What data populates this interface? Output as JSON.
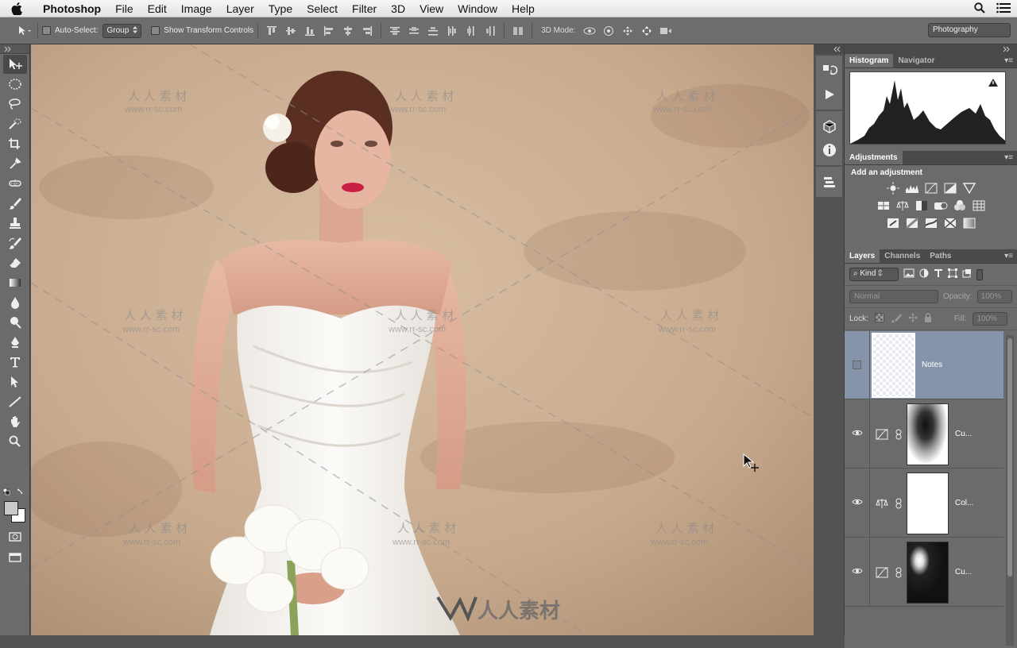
{
  "menubar": {
    "app_name": "Photoshop",
    "items": [
      "File",
      "Edit",
      "Image",
      "Layer",
      "Type",
      "Select",
      "Filter",
      "3D",
      "View",
      "Window",
      "Help"
    ]
  },
  "options_bar": {
    "auto_select_label": "Auto-Select:",
    "auto_select_value": "Group",
    "transform_controls_label": "Show Transform Controls",
    "mode_3d_label": "3D Mode:",
    "workspace": "Photography"
  },
  "tools": [
    "move-tool",
    "marquee-tool",
    "lasso-tool",
    "quick-select-tool",
    "crop-tool",
    "eyedropper-tool",
    "spot-healing-tool",
    "brush-tool",
    "clone-stamp-tool",
    "history-brush-tool",
    "eraser-tool",
    "gradient-tool",
    "blur-tool",
    "dodge-tool",
    "pen-tool",
    "type-tool",
    "path-select-tool",
    "line-tool",
    "hand-tool",
    "zoom-tool"
  ],
  "histogram_panel": {
    "tabs": [
      "Histogram",
      "Navigator"
    ]
  },
  "adjustments_panel": {
    "tab": "Adjustments",
    "title": "Add an adjustment"
  },
  "layers_panel": {
    "tabs": [
      "Layers",
      "Channels",
      "Paths"
    ],
    "filter_kind": "Kind",
    "blend_mode": "Normal",
    "opacity_label": "Opacity:",
    "opacity_value": "100%",
    "lock_label": "Lock:",
    "fill_label": "Fill:",
    "fill_value": "100%",
    "layers": [
      {
        "name": "Notes",
        "selected": true,
        "visible": false
      },
      {
        "name": "Cu...",
        "selected": false,
        "visible": true,
        "icon": "curves-icon"
      },
      {
        "name": "Col...",
        "selected": false,
        "visible": true,
        "icon": "color-balance-icon"
      },
      {
        "name": "Cu...",
        "selected": false,
        "visible": true,
        "icon": "curves-icon"
      }
    ]
  },
  "watermark": {
    "site": "www.rr-sc.com",
    "cn": "人人素材"
  },
  "colors": {
    "selected_layer": "#8593ab",
    "panel_bg": "#6b6b6b",
    "backdrop": "#c9ac90"
  }
}
